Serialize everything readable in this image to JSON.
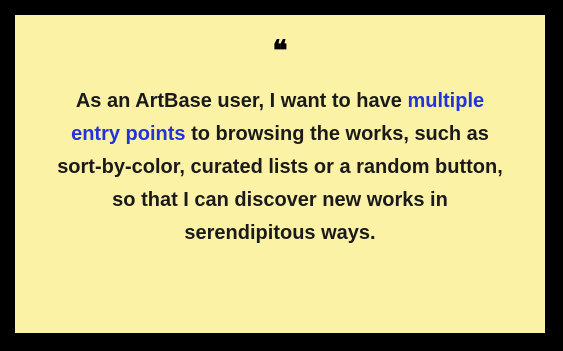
{
  "quote": {
    "mark": "❝",
    "text_before_link": "As an ArtBase user, I want to have ",
    "link_text": "multiple entry points",
    "text_after_link": " to browsing the works, such as sort-by-color, curated lists or a random button, so that I can discover new works in serendipitous ways."
  },
  "colors": {
    "card_background": "#fcf2a6",
    "border": "#000000",
    "link": "#2233dd",
    "text": "#1a1a1a"
  }
}
